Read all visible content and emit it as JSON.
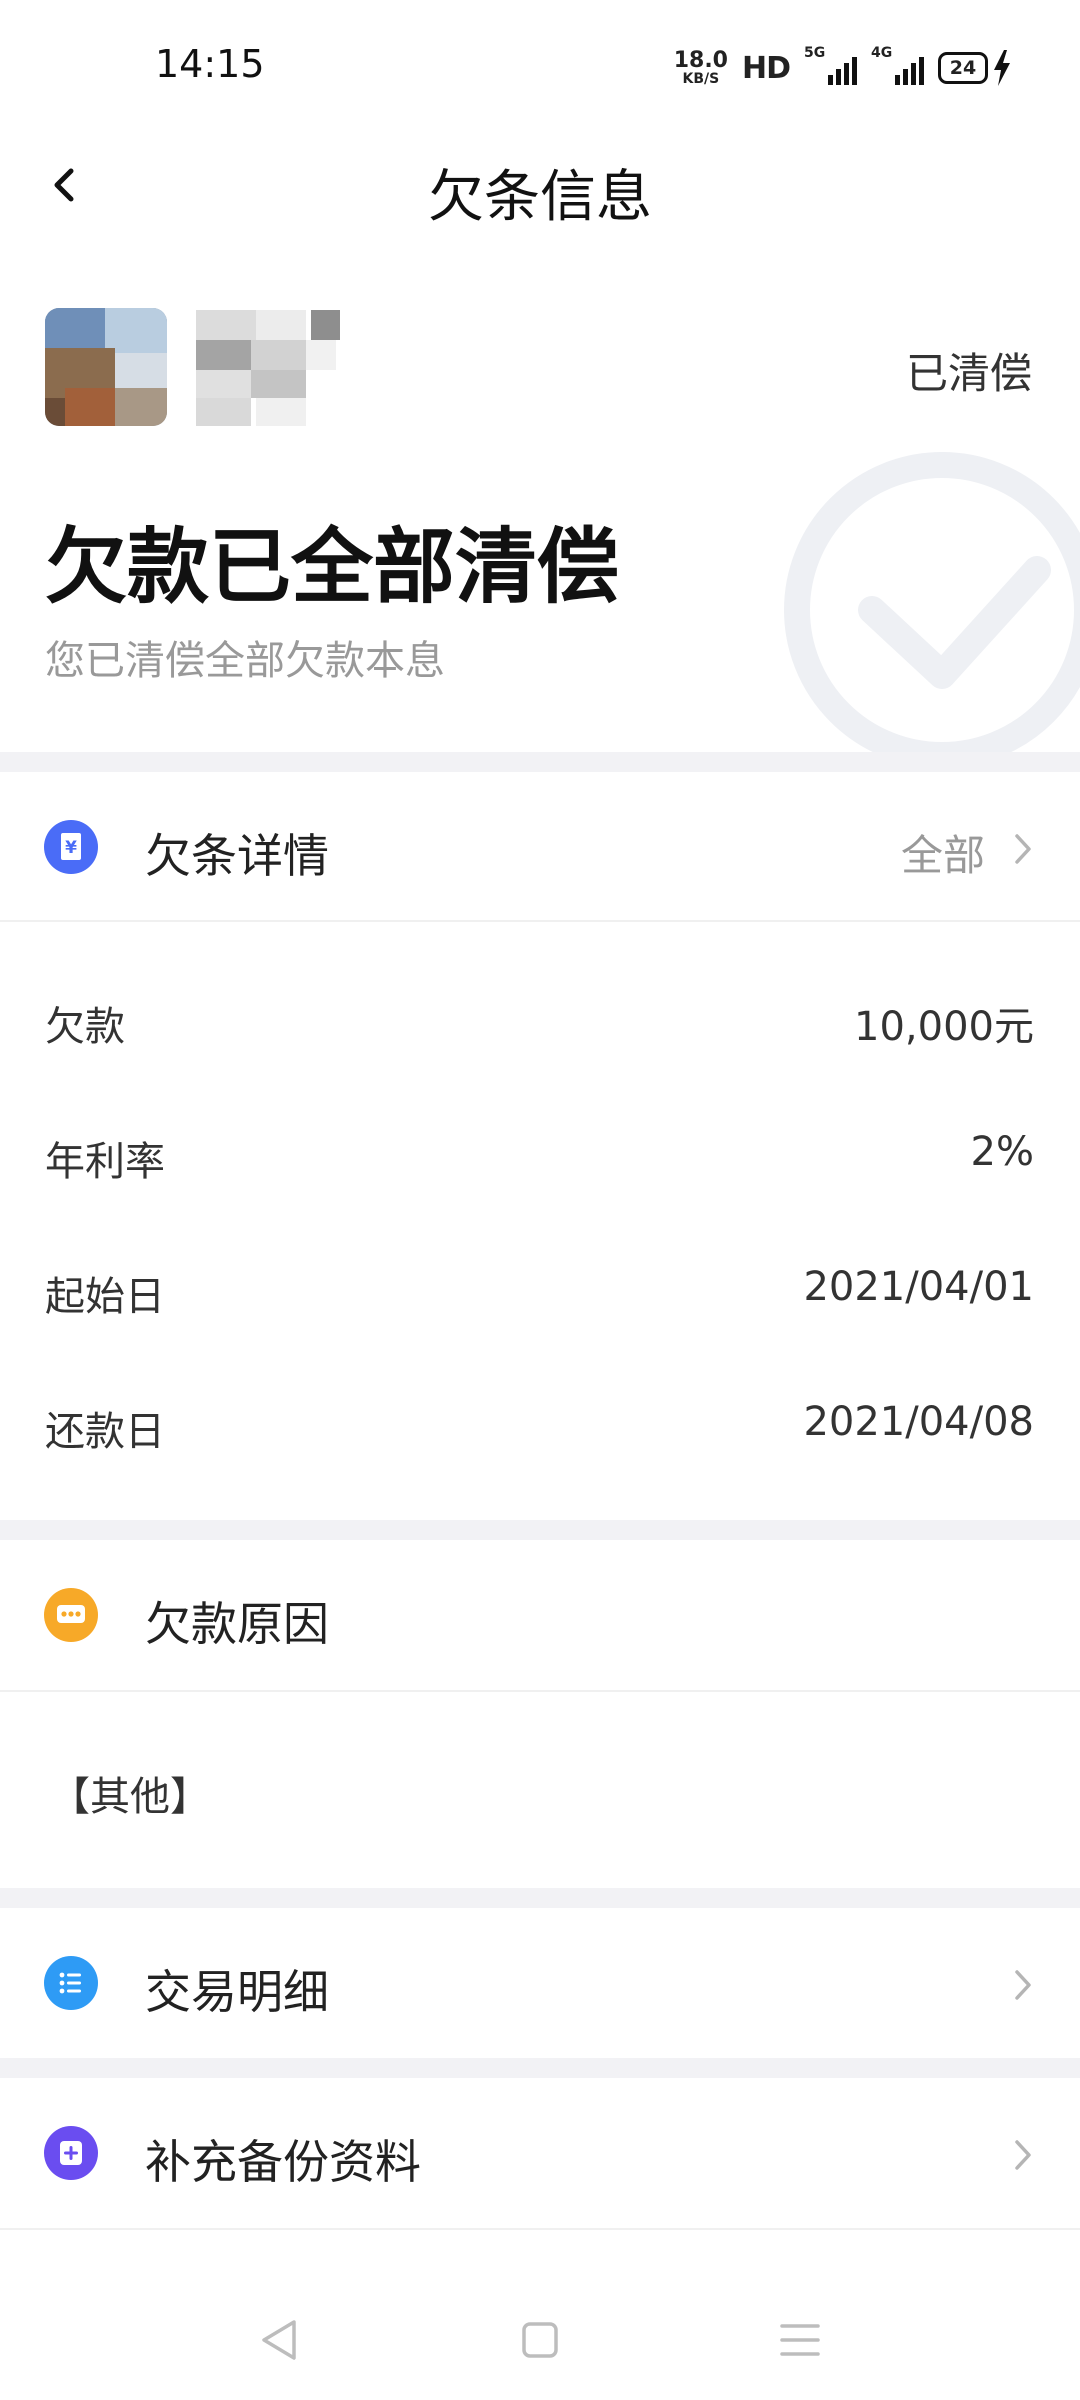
{
  "status_bar": {
    "time": "14:15",
    "net_speed_value": "18.0",
    "net_speed_unit": "KB/S",
    "hd_label": "HD",
    "signal_1_type": "5G",
    "signal_2_type": "4G",
    "battery_level": "24",
    "icons": [
      "signal-icon",
      "battery-icon",
      "charging-bolt-icon"
    ]
  },
  "header": {
    "title": "欠条信息",
    "back_icon": "back-arrow-icon"
  },
  "summary": {
    "status_tag": "已清偿",
    "title": "欠款已全部清偿",
    "subtitle": "您已清偿全部欠款本息",
    "watermark_icon": "check-circle-icon"
  },
  "details_section": {
    "label": "欠条详情",
    "right_link": "全部",
    "icon": "yen-receipt-icon",
    "icon_color": "#4a6cf7",
    "rows": [
      {
        "label": "欠款",
        "value": "10,000元"
      },
      {
        "label": "年利率",
        "value": "2%"
      },
      {
        "label": "起始日",
        "value": "2021/04/01"
      },
      {
        "label": "还款日",
        "value": "2021/04/08"
      }
    ]
  },
  "reason_section": {
    "label": "欠款原因",
    "icon": "chat-bubble-icon",
    "icon_color": "#f7a928",
    "text": "【其他】"
  },
  "transactions_section": {
    "label": "交易明细",
    "icon": "list-icon",
    "icon_color": "#2e9bf5"
  },
  "supplement_section": {
    "label": "补充备份资料",
    "icon": "plus-doc-icon",
    "icon_color": "#6a4df0"
  },
  "system_nav": {
    "icons": [
      "nav-back-icon",
      "nav-home-icon",
      "nav-menu-icon"
    ]
  }
}
